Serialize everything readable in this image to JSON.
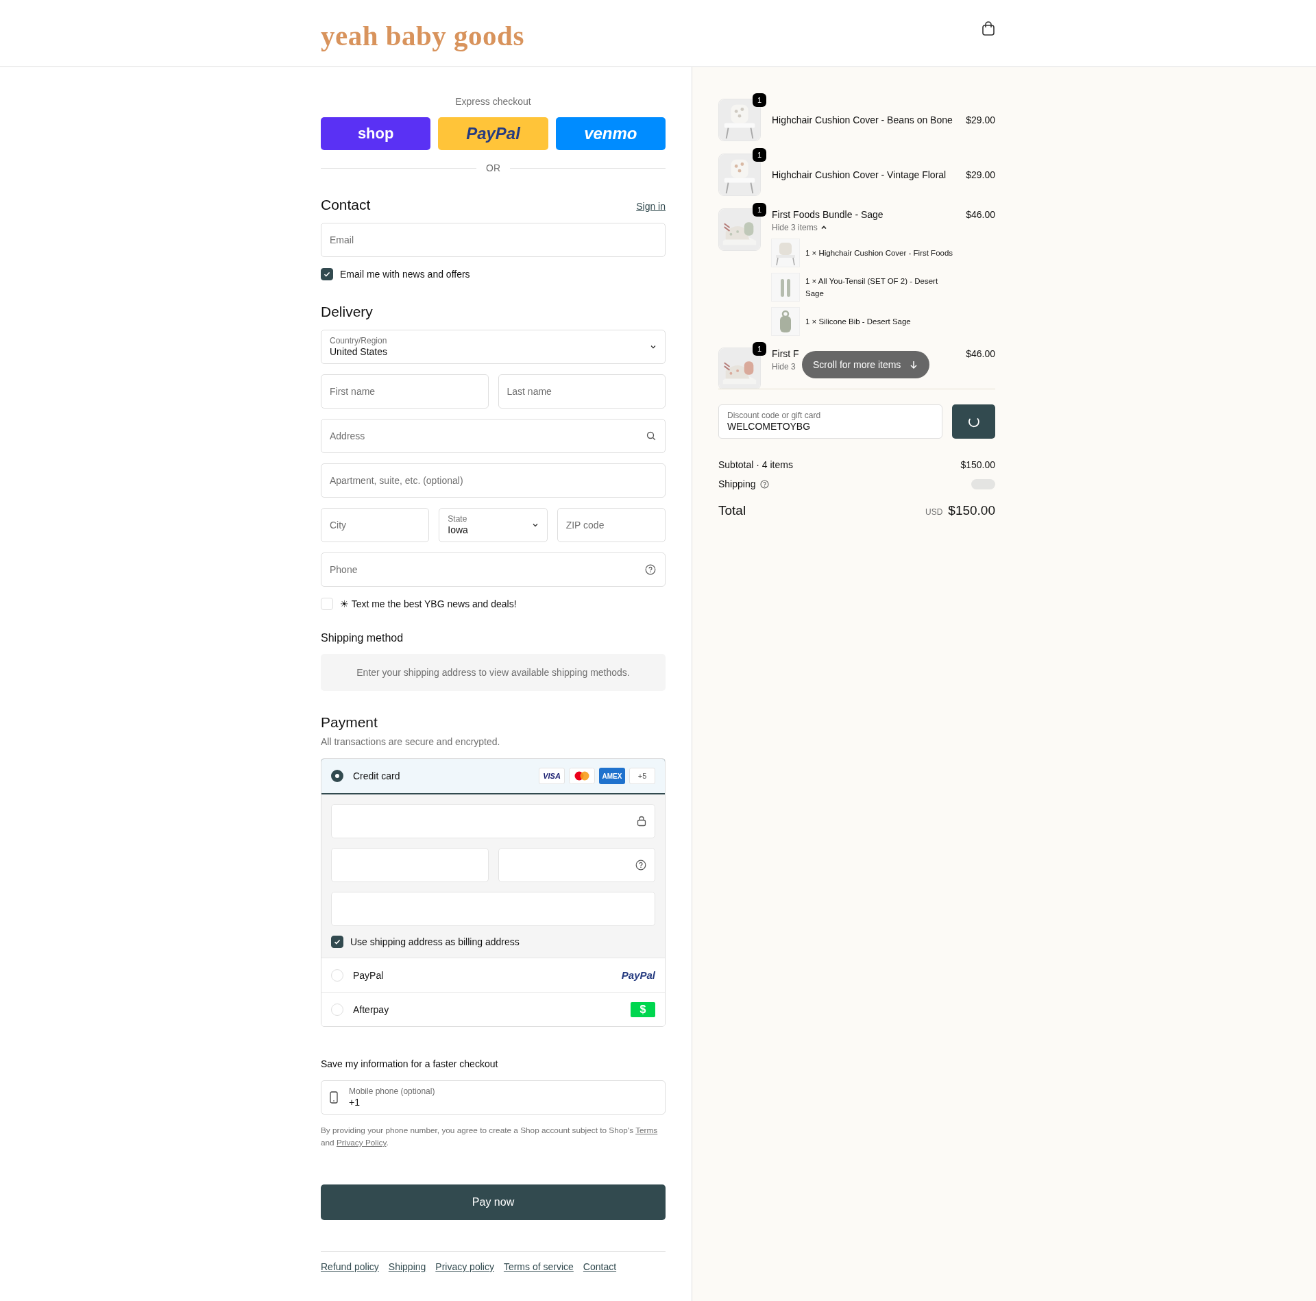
{
  "header": {
    "logo": "yeah baby goods"
  },
  "express_checkout": {
    "title": "Express checkout",
    "buttons": [
      {
        "kind": "shop",
        "label": "shop"
      },
      {
        "kind": "paypal",
        "label": "PayPal"
      },
      {
        "kind": "venmo",
        "label": "venmo"
      }
    ],
    "separator": "OR"
  },
  "contact": {
    "title": "Contact",
    "sign_in": "Sign in",
    "email": {
      "placeholder": "Email"
    },
    "news_checkbox": {
      "label": "Email me with news and offers",
      "checked": true
    }
  },
  "delivery": {
    "title": "Delivery",
    "rows": [
      [
        {
          "kind": "select",
          "label": "Country/Region",
          "value": "United States"
        }
      ],
      [
        {
          "kind": "text",
          "placeholder": "First name"
        },
        {
          "kind": "text",
          "placeholder": "Last name"
        }
      ],
      [
        {
          "kind": "search",
          "placeholder": "Address"
        }
      ],
      [
        {
          "kind": "text",
          "placeholder": "Apartment, suite, etc. (optional)"
        }
      ],
      [
        {
          "kind": "text",
          "placeholder": "City"
        },
        {
          "kind": "select",
          "label": "State",
          "value": "Iowa"
        },
        {
          "kind": "text",
          "placeholder": "ZIP code"
        }
      ],
      [
        {
          "kind": "help",
          "placeholder": "Phone"
        }
      ]
    ],
    "sms_checkbox": {
      "label": "☀ Text me the best YBG news and deals!",
      "checked": false
    }
  },
  "shipping_method": {
    "title": "Shipping method",
    "notice": "Enter your shipping address to view available shipping methods."
  },
  "payment": {
    "title": "Payment",
    "subtitle": "All transactions are secure and encrypted.",
    "methods": [
      {
        "kind": "card",
        "label": "Credit card",
        "selected": true,
        "brands": [
          {
            "kind": "visa",
            "label": "VISA"
          },
          {
            "kind": "mastercard"
          },
          {
            "kind": "amex",
            "label": "AMEX"
          },
          {
            "kind": "more",
            "label": "+5"
          }
        ]
      },
      {
        "kind": "paypal",
        "label": "PayPal",
        "selected": false,
        "logo": "PayPal"
      },
      {
        "kind": "afterpay",
        "label": "Afterpay",
        "selected": false,
        "logo": "$"
      }
    ],
    "billing_checkbox": {
      "label": "Use shipping address as billing address",
      "checked": true
    }
  },
  "save_info": {
    "title": "Save my information for a faster checkout",
    "mobile": {
      "label": "Mobile phone (optional)",
      "value": "+1"
    },
    "legal": [
      {
        "kind": "text",
        "text": "By providing your phone number, you agree to create a Shop account subject to Shop's "
      },
      {
        "kind": "link",
        "text": "Terms"
      },
      {
        "kind": "text",
        "text": " and "
      },
      {
        "kind": "link",
        "text": "Privacy Policy"
      },
      {
        "kind": "text",
        "text": "."
      }
    ]
  },
  "pay_button": "Pay now",
  "footer_links": [
    "Refund policy",
    "Shipping",
    "Privacy policy",
    "Terms of service",
    "Contact"
  ],
  "order_summary": {
    "items": [
      {
        "name": "Highchair Cushion Cover - Beans on Bone",
        "price": "$29.00",
        "quantity": "1"
      },
      {
        "name": "Highchair Cushion Cover - Vintage Floral",
        "price": "$29.00",
        "quantity": "1"
      },
      {
        "name": "First Foods Bundle - Sage",
        "price": "$46.00",
        "quantity": "1",
        "toggle": "Hide 3 items",
        "expanded": true,
        "components": [
          {
            "text": "1 × Highchair Cushion Cover - First Foods"
          },
          {
            "text": "1 × All You-Tensil (SET OF 2) - Desert Sage"
          },
          {
            "text": "1 × Silicone Bib - Desert Sage"
          }
        ]
      },
      {
        "name": "First F",
        "price": "$46.00",
        "quantity": "1",
        "toggle": "Hide 3"
      }
    ],
    "scroll_hint": "Scroll for more items",
    "discount": {
      "label": "Discount code or gift card",
      "value": "WELCOMETOYBG"
    },
    "subtotal": {
      "label": "Subtotal · 4 items",
      "value": "$150.00"
    },
    "shipping": {
      "label": "Shipping"
    },
    "total": {
      "label": "Total",
      "currency": "USD",
      "value": "$150.00"
    }
  }
}
